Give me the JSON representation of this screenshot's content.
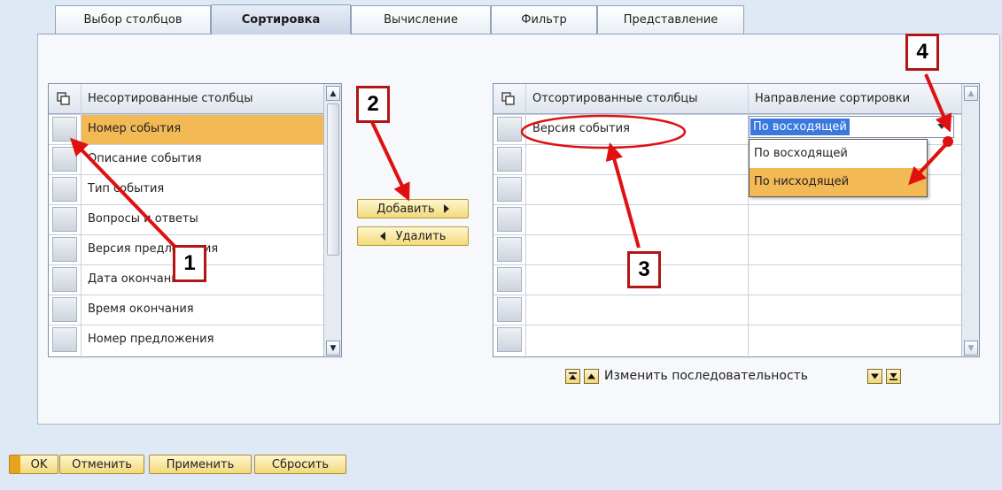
{
  "tabs": [
    {
      "label": "Выбор столбцов",
      "active": false
    },
    {
      "label": "Сортировка",
      "active": true
    },
    {
      "label": "Вычисление",
      "active": false
    },
    {
      "label": "Фильтр",
      "active": false
    },
    {
      "label": "Представление",
      "active": false
    }
  ],
  "left_table": {
    "header": "Несортированные столбцы",
    "rows": [
      "Номер события",
      "Описание события",
      "Тип события",
      "Вопросы и ответы",
      "Версия предложения",
      "Дата окончания",
      "Время окончания",
      "Номер предложения"
    ],
    "selected_index": 0
  },
  "middle_buttons": {
    "add": "Добавить",
    "remove": "Удалить"
  },
  "right_table": {
    "header_columns": "Отсортированные столбцы",
    "header_direction": "Направление сортировки",
    "rows": [
      {
        "column": "Версия события",
        "direction": "По восходящей"
      }
    ]
  },
  "dropdown": {
    "selected_value": "По восходящей",
    "options": [
      "По восходящей",
      "По нисходящей"
    ],
    "highlighted_index": 1
  },
  "sequence": {
    "label": "Изменить последовательность"
  },
  "footer": {
    "ok": "OK",
    "cancel": "Отменить",
    "apply": "Применить",
    "reset": "Сбросить"
  },
  "annotations": {
    "c1": "1",
    "c2": "2",
    "c3": "3",
    "c4": "4"
  },
  "colors": {
    "selected_row": "#f2b955",
    "highlight_blue": "#3a78e0",
    "annotation_red": "#e01010",
    "button_yellow": "#f3d97b"
  },
  "icons": {
    "column_chooser": "column-chooser-icon",
    "scroll_up": "scroll-up-icon",
    "scroll_down": "scroll-down-icon",
    "dropdown_arrow": "chevron-down-icon",
    "move_top": "move-top-icon",
    "move_up": "move-up-icon",
    "move_down": "move-down-icon",
    "move_bottom": "move-bottom-icon"
  }
}
